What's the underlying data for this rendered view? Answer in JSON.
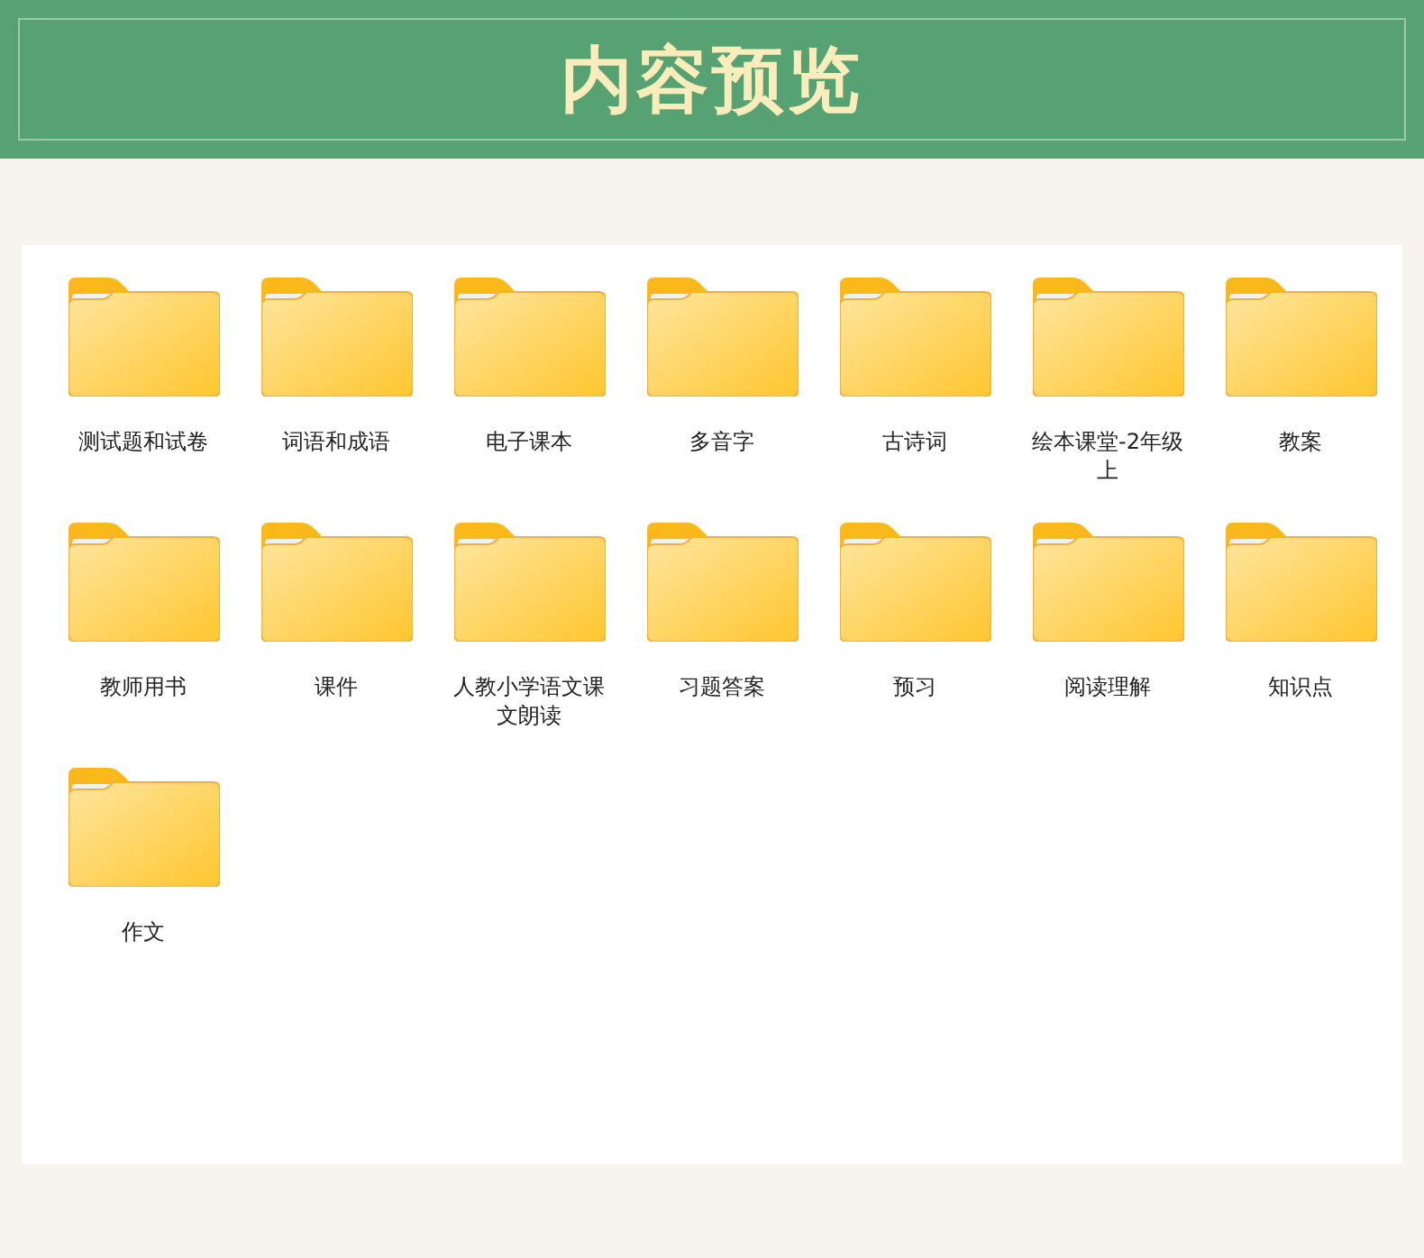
{
  "header": {
    "title": "内容预览"
  },
  "folders": [
    {
      "label": "测试题和试卷"
    },
    {
      "label": "词语和成语"
    },
    {
      "label": "电子课本"
    },
    {
      "label": "多音字"
    },
    {
      "label": "古诗词"
    },
    {
      "label": "绘本课堂-2年级上"
    },
    {
      "label": "教案"
    },
    {
      "label": "教师用书"
    },
    {
      "label": "课件"
    },
    {
      "label": "人教小学语文课文朗读"
    },
    {
      "label": "习题答案"
    },
    {
      "label": "预习"
    },
    {
      "label": "阅读理解"
    },
    {
      "label": "知识点"
    },
    {
      "label": "作文"
    }
  ]
}
